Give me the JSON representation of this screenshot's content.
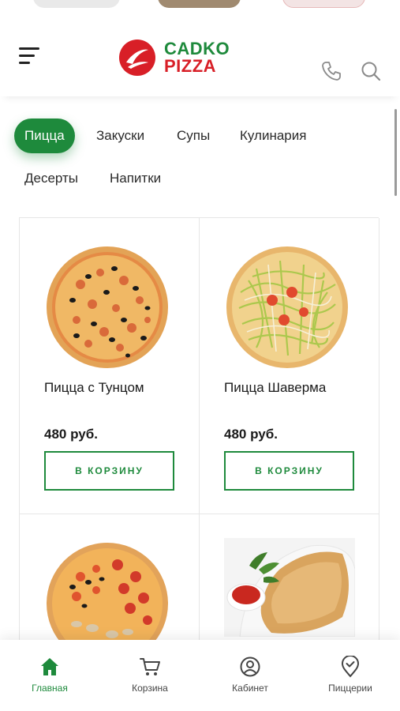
{
  "brand": {
    "line1": "CADKO",
    "line2": "PIZZA",
    "green": "#1e8a3c",
    "red": "#d81f27"
  },
  "header": {
    "menu_icon": "menu-icon",
    "phone_icon": "phone-icon",
    "search_icon": "search-icon"
  },
  "categories": [
    {
      "label": "Пицца",
      "active": true
    },
    {
      "label": "Закуски",
      "active": false
    },
    {
      "label": "Супы",
      "active": false
    },
    {
      "label": "Кулинария",
      "active": false
    },
    {
      "label": "Десерты",
      "active": false
    },
    {
      "label": "Напитки",
      "active": false
    }
  ],
  "products": [
    {
      "name": "Пицца с Тунцом",
      "price": "480 руб.",
      "button": "В КОРЗИНУ"
    },
    {
      "name": "Пицца Шаверма",
      "price": "480 руб.",
      "button": "В КОРЗИНУ"
    },
    {
      "name": "",
      "price": "",
      "button": ""
    },
    {
      "name": "",
      "price": "",
      "button": ""
    }
  ],
  "bottom_nav": [
    {
      "label": "Главная",
      "icon": "home-icon",
      "active": true
    },
    {
      "label": "Корзина",
      "icon": "cart-icon",
      "active": false
    },
    {
      "label": "Кабинет",
      "icon": "account-icon",
      "active": false
    },
    {
      "label": "Пиццерии",
      "icon": "location-icon",
      "active": false
    }
  ]
}
